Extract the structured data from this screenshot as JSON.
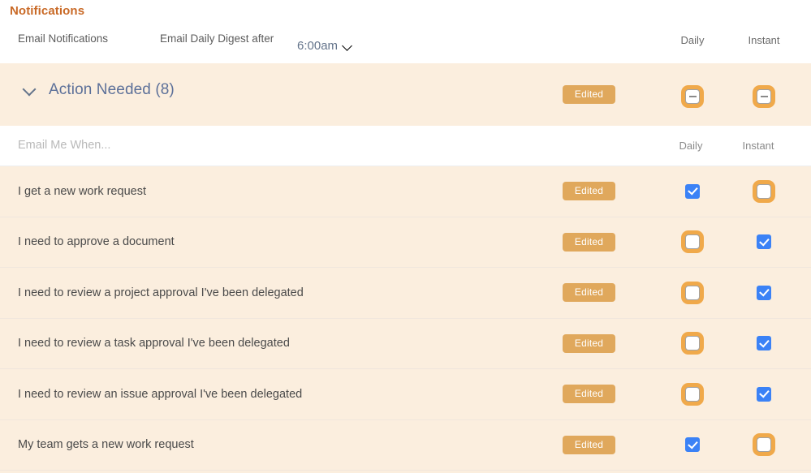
{
  "section": {
    "title": "Notifications"
  },
  "settings": {
    "email_notifications_label": "Email Notifications",
    "digest_label": "Email Daily Digest after",
    "digest_value": "6:00am",
    "digest_chevron_icon": "chevron-down-icon",
    "columns": {
      "daily": "Daily",
      "instant": "Instant"
    }
  },
  "group": {
    "chevron_icon": "chevron-down-icon",
    "title": "Action Needed (8)",
    "badge": "Edited",
    "daily_state": "indeterminate",
    "instant_state": "indeterminate",
    "daily_ring": true,
    "instant_ring": true
  },
  "subheader": {
    "when_label": "Email Me When...",
    "daily": "Daily",
    "instant": "Instant"
  },
  "rows": [
    {
      "label": "I get a new work request",
      "badge": "Edited",
      "daily_state": "checked",
      "daily_ring": false,
      "instant_state": "unchecked",
      "instant_ring": true
    },
    {
      "label": "I need to approve a document",
      "badge": "Edited",
      "daily_state": "unchecked",
      "daily_ring": true,
      "instant_state": "checked",
      "instant_ring": false
    },
    {
      "label": "I need to review a project approval I've been delegated",
      "badge": "Edited",
      "daily_state": "unchecked",
      "daily_ring": true,
      "instant_state": "checked",
      "instant_ring": false
    },
    {
      "label": "I need to review a task approval I've been delegated",
      "badge": "Edited",
      "daily_state": "unchecked",
      "daily_ring": true,
      "instant_state": "checked",
      "instant_ring": false
    },
    {
      "label": "I need to review an issue approval I've been delegated",
      "badge": "Edited",
      "daily_state": "unchecked",
      "daily_ring": true,
      "instant_state": "checked",
      "instant_ring": false
    },
    {
      "label": "My team gets a new work request",
      "badge": "Edited",
      "daily_state": "checked",
      "daily_ring": false,
      "instant_state": "unchecked",
      "instant_ring": true
    }
  ],
  "colors": {
    "heading": "#c96a27",
    "band": "#fbeede",
    "badge": "#e0a85c",
    "checkbox_checked": "#3b82f6",
    "focus_ring": "#f0a94a",
    "group_title": "#5c7099",
    "select_value": "#64748b"
  }
}
